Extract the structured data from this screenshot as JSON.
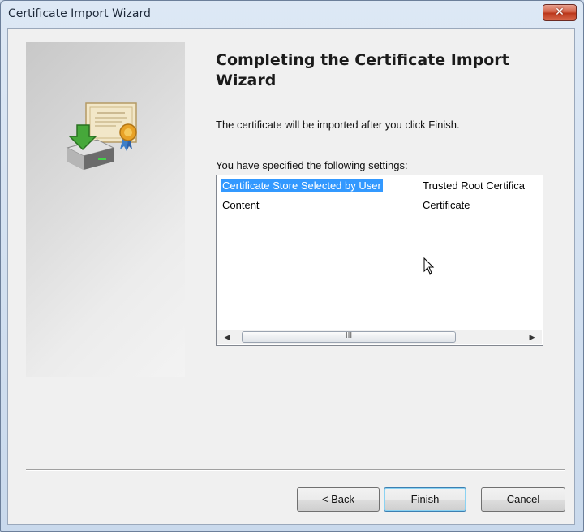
{
  "window": {
    "title": "Certificate Import Wizard",
    "close_label": "✕"
  },
  "main": {
    "heading": "Completing the Certificate Import Wizard",
    "description": "The certificate will be imported after you click Finish.",
    "settings_label": "You have specified the following settings:"
  },
  "settings": {
    "rows": [
      {
        "name": "Certificate Store Selected by User",
        "value": "Trusted Root Certifica"
      },
      {
        "name": "Content",
        "value": "Certificate"
      }
    ],
    "scroll_grip": "III"
  },
  "buttons": {
    "back": "< Back",
    "finish": "Finish",
    "cancel": "Cancel"
  },
  "icons": {
    "wizard": "certificate-import-icon",
    "cursor": "mouse-pointer-icon"
  },
  "colors": {
    "selection": "#3399ff",
    "title_bar": "#dde8f5",
    "close_button": "#c94a2e"
  }
}
